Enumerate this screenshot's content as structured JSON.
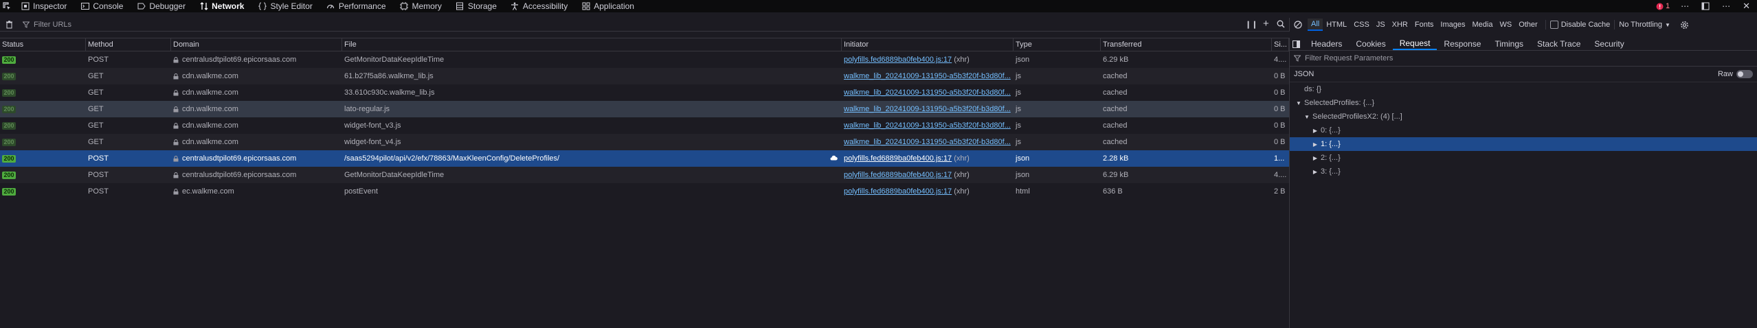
{
  "colors": {
    "accent": "#0a84ff",
    "status_ok": "#4fab3f",
    "link": "#75bfff",
    "selected_row": "#1e4a8c"
  },
  "toolbar": {
    "tabs": [
      {
        "icon": "inspector-icon",
        "label": "Inspector"
      },
      {
        "icon": "console-icon",
        "label": "Console"
      },
      {
        "icon": "debugger-icon",
        "label": "Debugger"
      },
      {
        "icon": "network-icon",
        "label": "Network",
        "active": true
      },
      {
        "icon": "style-editor-icon",
        "label": "Style Editor"
      },
      {
        "icon": "performance-icon",
        "label": "Performance"
      },
      {
        "icon": "memory-icon",
        "label": "Memory"
      },
      {
        "icon": "storage-icon",
        "label": "Storage"
      },
      {
        "icon": "accessibility-icon",
        "label": "Accessibility"
      },
      {
        "icon": "application-icon",
        "label": "Application"
      }
    ],
    "error_count": "1"
  },
  "filter": {
    "placeholder": "Filter URLs"
  },
  "type_filters": {
    "items": [
      "All",
      "HTML",
      "CSS",
      "JS",
      "XHR",
      "Fonts",
      "Images",
      "Media",
      "WS",
      "Other"
    ],
    "active": "All"
  },
  "options": {
    "disable_cache": "Disable Cache",
    "throttling": "No Throttling"
  },
  "columns": {
    "status": "Status",
    "method": "Method",
    "domain": "Domain",
    "file": "File",
    "initiator": "Initiator",
    "type": "Type",
    "transferred": "Transferred",
    "size": "Si..."
  },
  "rows": [
    {
      "status": "200",
      "cached": false,
      "method": "POST",
      "domain": "centralusdtpilot69.epicorsaas.com",
      "file": "GetMonitorDataKeepIdleTime",
      "initiator": "polyfills.fed6889ba0feb400.js:17",
      "initiator_extra": "(xhr)",
      "type": "json",
      "transferred": "6.29 kB",
      "size": "4...."
    },
    {
      "status": "200",
      "cached": true,
      "method": "GET",
      "domain": "cdn.walkme.com",
      "file": "61.b27f5a86.walkme_lib.js",
      "initiator": "walkme_lib_20241009-131950-a5b3f20f-b3d80f...",
      "initiator_extra": "",
      "type": "js",
      "transferred": "cached",
      "size": "0 B"
    },
    {
      "status": "200",
      "cached": true,
      "method": "GET",
      "domain": "cdn.walkme.com",
      "file": "33.610c930c.walkme_lib.js",
      "initiator": "walkme_lib_20241009-131950-a5b3f20f-b3d80f...",
      "initiator_extra": "",
      "type": "js",
      "transferred": "cached",
      "size": "0 B"
    },
    {
      "status": "200",
      "cached": true,
      "method": "GET",
      "domain": "cdn.walkme.com",
      "file": "lato-regular.js",
      "initiator": "walkme_lib_20241009-131950-a5b3f20f-b3d80f...",
      "initiator_extra": "",
      "type": "js",
      "transferred": "cached",
      "size": "0 B"
    },
    {
      "status": "200",
      "cached": true,
      "method": "GET",
      "domain": "cdn.walkme.com",
      "file": "widget-font_v3.js",
      "initiator": "walkme_lib_20241009-131950-a5b3f20f-b3d80f...",
      "initiator_extra": "",
      "type": "js",
      "transferred": "cached",
      "size": "0 B"
    },
    {
      "status": "200",
      "cached": true,
      "method": "GET",
      "domain": "cdn.walkme.com",
      "file": "widget-font_v4.js",
      "initiator": "walkme_lib_20241009-131950-a5b3f20f-b3d80f...",
      "initiator_extra": "",
      "type": "js",
      "transferred": "cached",
      "size": "0 B"
    },
    {
      "status": "200",
      "cached": false,
      "method": "POST",
      "domain": "centralusdtpilot69.epicorsaas.com",
      "file": "/saas5294pilot/api/v2/efx/78863/MaxKleenConfig/DeleteProfiles/",
      "initiator": "polyfills.fed6889ba0feb400.js:17",
      "initiator_extra": "(xhr)",
      "type": "json",
      "transferred": "2.28 kB",
      "size": "1..."
    },
    {
      "status": "200",
      "cached": false,
      "method": "POST",
      "domain": "centralusdtpilot69.epicorsaas.com",
      "file": "GetMonitorDataKeepIdleTime",
      "initiator": "polyfills.fed6889ba0feb400.js:17",
      "initiator_extra": "(xhr)",
      "type": "json",
      "transferred": "6.29 kB",
      "size": "4...."
    },
    {
      "status": "200",
      "cached": false,
      "method": "POST",
      "domain": "ec.walkme.com",
      "file": "postEvent",
      "initiator": "polyfills.fed6889ba0feb400.js:17",
      "initiator_extra": "(xhr)",
      "type": "html",
      "transferred": "636 B",
      "size": "2 B"
    }
  ],
  "panel": {
    "tabs": [
      "Headers",
      "Cookies",
      "Request",
      "Response",
      "Timings",
      "Stack Trace",
      "Security"
    ],
    "active_tab": "Request",
    "filter_placeholder": "Filter Request Parameters",
    "json_label": "JSON",
    "raw_label": "Raw",
    "tree": [
      {
        "label": "ds: {}",
        "level": 0,
        "twisty": ""
      },
      {
        "label": "SelectedProfiles: {...}",
        "level": 0,
        "twisty": "▼"
      },
      {
        "label": "SelectedProfilesX2: (4) [...]",
        "level": 1,
        "twisty": "▼"
      },
      {
        "label": "0: {...}",
        "level": 2,
        "twisty": "▶"
      },
      {
        "label": "1: {...}",
        "level": 2,
        "twisty": "▶",
        "selected": true
      },
      {
        "label": "2: {...}",
        "level": 2,
        "twisty": "▶"
      },
      {
        "label": "3: {...}",
        "level": 2,
        "twisty": "▶"
      }
    ]
  }
}
